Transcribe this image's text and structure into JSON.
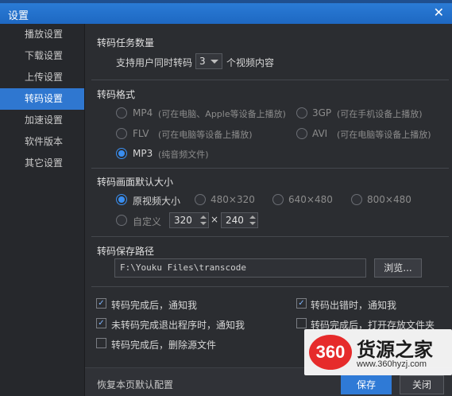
{
  "window": {
    "title": "设置",
    "close_glyph": "✕"
  },
  "sidebar": {
    "items": [
      {
        "label": "播放设置",
        "active": false
      },
      {
        "label": "下载设置",
        "active": false
      },
      {
        "label": "上传设置",
        "active": false
      },
      {
        "label": "转码设置",
        "active": true
      },
      {
        "label": "加速设置",
        "active": false
      },
      {
        "label": "软件版本",
        "active": false
      },
      {
        "label": "其它设置",
        "active": false
      }
    ]
  },
  "task_count": {
    "title": "转码任务数量",
    "prefix": "支持用户同时转码",
    "value": "3",
    "suffix": "个视频内容"
  },
  "format": {
    "title": "转码格式",
    "options": [
      {
        "label": "MP4",
        "desc": "(可在电脑、Apple等设备上播放)",
        "checked": false
      },
      {
        "label": "3GP",
        "desc": "(可在手机设备上播放)",
        "checked": false
      },
      {
        "label": "FLV",
        "desc": "(可在电脑等设备上播放)",
        "checked": false
      },
      {
        "label": "AVI",
        "desc": "(可在电脑等设备上播放)",
        "checked": false
      },
      {
        "label": "MP3",
        "desc": "(纯音频文件)",
        "checked": true
      }
    ]
  },
  "size": {
    "title": "转码画面默认大小",
    "options": [
      {
        "label": "原视频大小",
        "checked": true
      },
      {
        "label": "480×320",
        "checked": false
      },
      {
        "label": "640×480",
        "checked": false
      },
      {
        "label": "800×480",
        "checked": false
      }
    ],
    "custom_label": "自定义",
    "custom_width": "320",
    "custom_times": "×",
    "custom_height": "240"
  },
  "path": {
    "title": "转码保存路径",
    "value": "F:\\Youku Files\\transcode",
    "browse_label": "浏览..."
  },
  "notify": {
    "items": [
      {
        "label": "转码完成后，通知我",
        "checked": true
      },
      {
        "label": "转码出错时，通知我",
        "checked": true
      },
      {
        "label": "未转码完成退出程序时，通知我",
        "checked": true
      },
      {
        "label": "转码完成后，打开存放文件夹",
        "checked": false
      },
      {
        "label": "转码完成后，删除源文件",
        "checked": false
      }
    ],
    "check_glyph": "✓"
  },
  "footer": {
    "restore_label": "恢复本页默认配置",
    "save_label": "保存",
    "close_label": "关闭"
  },
  "watermark": {
    "logo_text": "360",
    "name": "货源之家",
    "url": "www.360hyzj.com"
  }
}
